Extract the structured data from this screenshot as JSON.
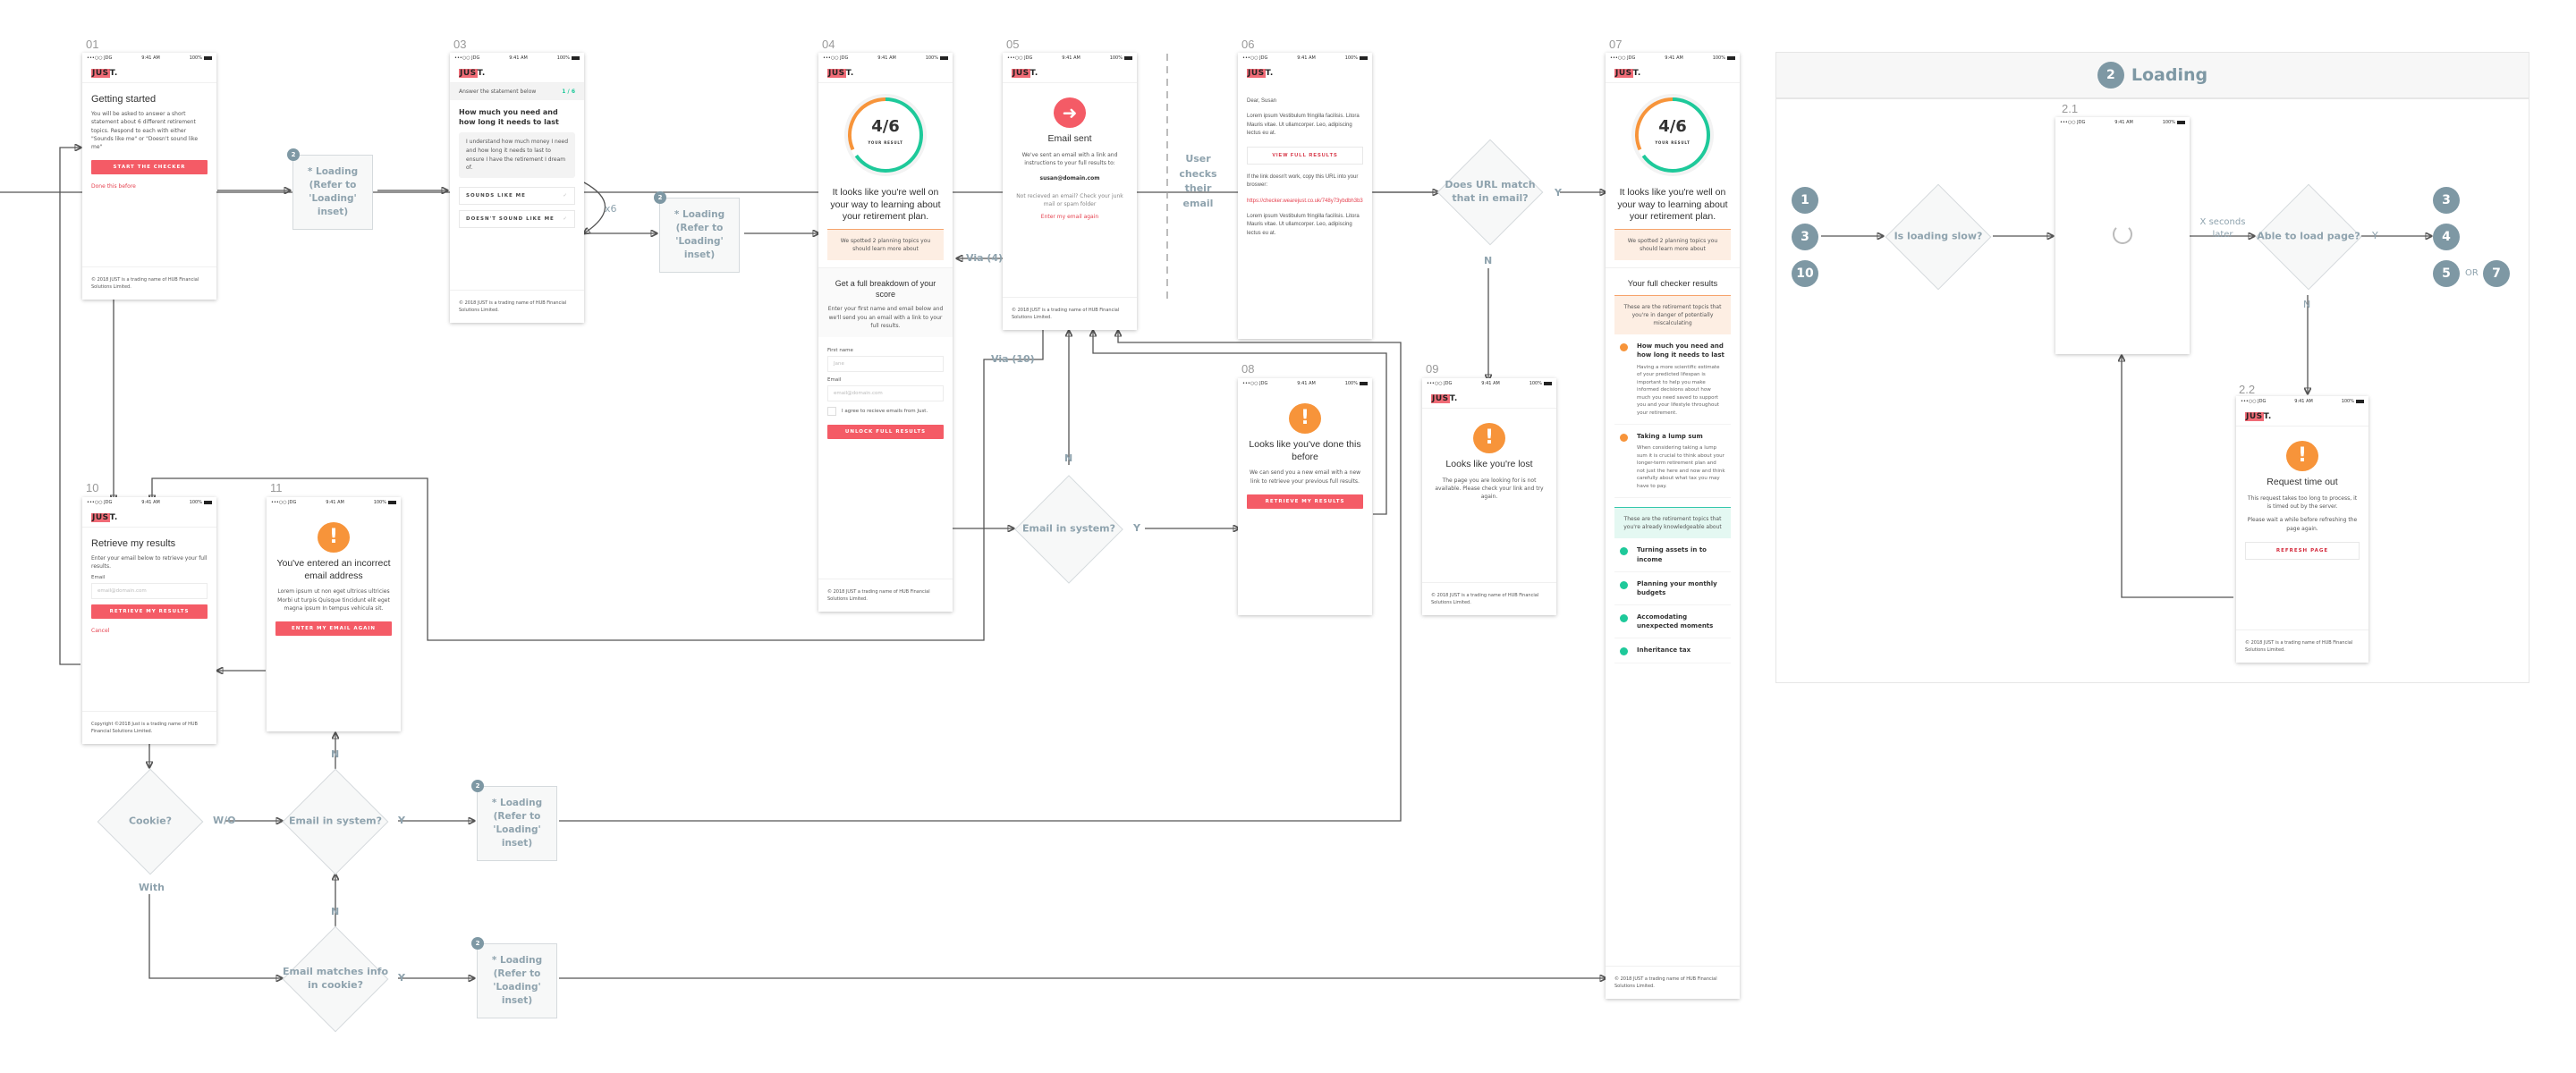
{
  "common": {
    "status_carrier": "•••○○ JDG",
    "status_time": "9:41 AM",
    "status_battery": "100%",
    "logo_main": "JUS",
    "logo_tail": "T.",
    "footer": "© 2018 JUST is a trading name of HUB Financial Solutions Limited.",
    "footer_alt": "© 2018 JUST a trading name of HUB Financial Solutions Limited.",
    "footer_copyright": "Copyright ©2018 Just is a trading name of HUB Financial Solutions Limited."
  },
  "colors": {
    "brand_red": "#f45b66",
    "warning_orange": "#f7943a",
    "success_green": "#1ec99a",
    "flow_gray": "#8fa3ae",
    "badge_gray": "#7e98a4"
  },
  "screens": {
    "s01": {
      "number": "01",
      "title": "Getting started",
      "body": "You will be asked to answer a short statement about 6 different retirement topics. Respond to each with either \"Sounds like me\" or \"Doesn't sound like me\"",
      "primary_button": "START THE CHECKER",
      "link": "Done this before"
    },
    "s03": {
      "number": "03",
      "band_label": "Answer the statement below",
      "counter": "1 / 6",
      "title": "How much you need and how long it needs to last",
      "statement": "I understand how much money I need and how long it needs to last to ensure I have the retirement I dream of.",
      "choice_yes": "SOUNDS LIKE ME",
      "choice_no": "DOESN'T SOUND LIKE ME",
      "repeat_label": "x6"
    },
    "s04": {
      "number": "04",
      "score": "4/6",
      "score_label": "YOUR RESULT",
      "score_fraction": 0.667,
      "headline": "It looks like you're well on your way to learning about your retirement plan.",
      "spotted": "We spotted 2 planning topics you should learn more about",
      "breakdown_title": "Get a full breakdown of your score",
      "breakdown_body": "Enter your first name and email below and we'll send you an email with a link to your full results.",
      "first_name_label": "First name",
      "first_name_placeholder": "Jane",
      "email_label": "Email",
      "email_placeholder": "email@domain.com",
      "consent": "I agree to recieve emails from Just.",
      "button": "UNLOCK FULL RESULTS"
    },
    "s05": {
      "number": "05",
      "title": "Email sent",
      "body": "We've sent an email with a link and instructions to your full results to:",
      "email": "susan@domain.com",
      "not_received": "Not recieved an email? Check your junk mail or spam folder",
      "link": "Enter my email again"
    },
    "s06": {
      "number": "06",
      "greeting": "Dear, Susan",
      "para1": "Lorem ipsum Vestibulum fringilla facilisis. Litora Mauris vitae. Ut ullamcorper. Leo, adipiscing lectus eu at.",
      "button": "VIEW FULL RESULTS",
      "url_intro": "If the link doesn't work, copy this URL into your broswer:",
      "url": "https://checker.wearejust.co.uk/748y73ybdbh3b3",
      "para2": "Lorem ipsum Vestibulum fringilla facilisis. Litora Mauris vitae. Ut ullamcorper. Leo, adipiscing lectus eu at."
    },
    "s07": {
      "number": "07",
      "score": "4/6",
      "score_label": "YOUR RESULT",
      "score_fraction": 0.667,
      "headline": "It looks like you're well on your way to learning about your retirement plan.",
      "spotted": "We spotted 2 planning topics you should learn more about",
      "results_title": "Your full checker results",
      "danger_intro": "These are the retirement topcis that you're in danger of potentially miscalculating",
      "danger_topics": [
        {
          "title": "How much you need and how long it needs to last",
          "desc": "Having a more scientific estimate of your predicted lifespan is important to help you make informed decisions about how much you need saved to support you and your lifestyle throughout your retirement."
        },
        {
          "title": "Taking a lump sum",
          "desc": "When considering taking a lump sum it is crucial to think about your longer-term retirement plan and not just the here and now and think carefully about what tax you may have to pay."
        }
      ],
      "known_intro": "These are the retirement topics that you're already knowledgeable about",
      "known_topics": [
        {
          "title": "Turning assets in to income"
        },
        {
          "title": "Planning your monthly budgets"
        },
        {
          "title": "Accomodating unexpected moments"
        },
        {
          "title": "Inheritance tax"
        }
      ]
    },
    "s08": {
      "number": "08",
      "title": "Looks like you've done this before",
      "body": "We can send you a new email with a new link to retrieve your previous full results.",
      "button": "RETRIEVE MY RESULTS"
    },
    "s09": {
      "number": "09",
      "title": "Looks like you're lost",
      "body": "The page you are looking for is not available. Please check your link and try again."
    },
    "s10": {
      "number": "10",
      "title": "Retrieve my results",
      "body": "Enter your email below to retrieve your full results.",
      "email_label": "Email",
      "email_placeholder": "email@domain.com",
      "button": "RETRIEVE MY RESULTS",
      "link": "Cancel"
    },
    "s11": {
      "number": "11",
      "title": "You've entered an incorrect email address",
      "body": "Lorem ipsum ut non eget ultrices ultricies Morbi ut turpis Quisque tincidunt elit eget magna ipsum In tempus vehicula sit.",
      "button": "ENTER MY EMAIL AGAIN"
    },
    "s21": {
      "number": "2.1"
    },
    "s22": {
      "number": "2.2",
      "title": "Request time out",
      "body1": "This request takes too long to process, it is timed out by the server.",
      "body2": "Please wait a while before refreshing the page again.",
      "button": "REFRESH PAGE"
    }
  },
  "flow": {
    "loading_box": "* Loading (Refer to 'Loading' inset)",
    "loading_badge": "2",
    "decisions": {
      "email_in_system": "Email in system?",
      "url_match": "Does URL match that in email?",
      "cookie": "Cookie?",
      "email_in_system_2": "Email in system?",
      "email_matches_cookie": "Email matches info in cookie?",
      "is_loading_slow": "Is loading slow?",
      "able_to_load": "Able to load page?"
    },
    "labels": {
      "yes": "Y",
      "no": "N",
      "without": "W/O",
      "with": "With",
      "via4": "Via (4)",
      "via10": "Via (10)",
      "user_checks": "User checks their email",
      "x_seconds": "X seconds later",
      "or": "OR"
    }
  },
  "inset": {
    "badge": "2",
    "title": "Loading",
    "inputs": [
      "1",
      "3",
      "10"
    ],
    "outputs": [
      "3",
      "4",
      "5",
      "7"
    ]
  }
}
